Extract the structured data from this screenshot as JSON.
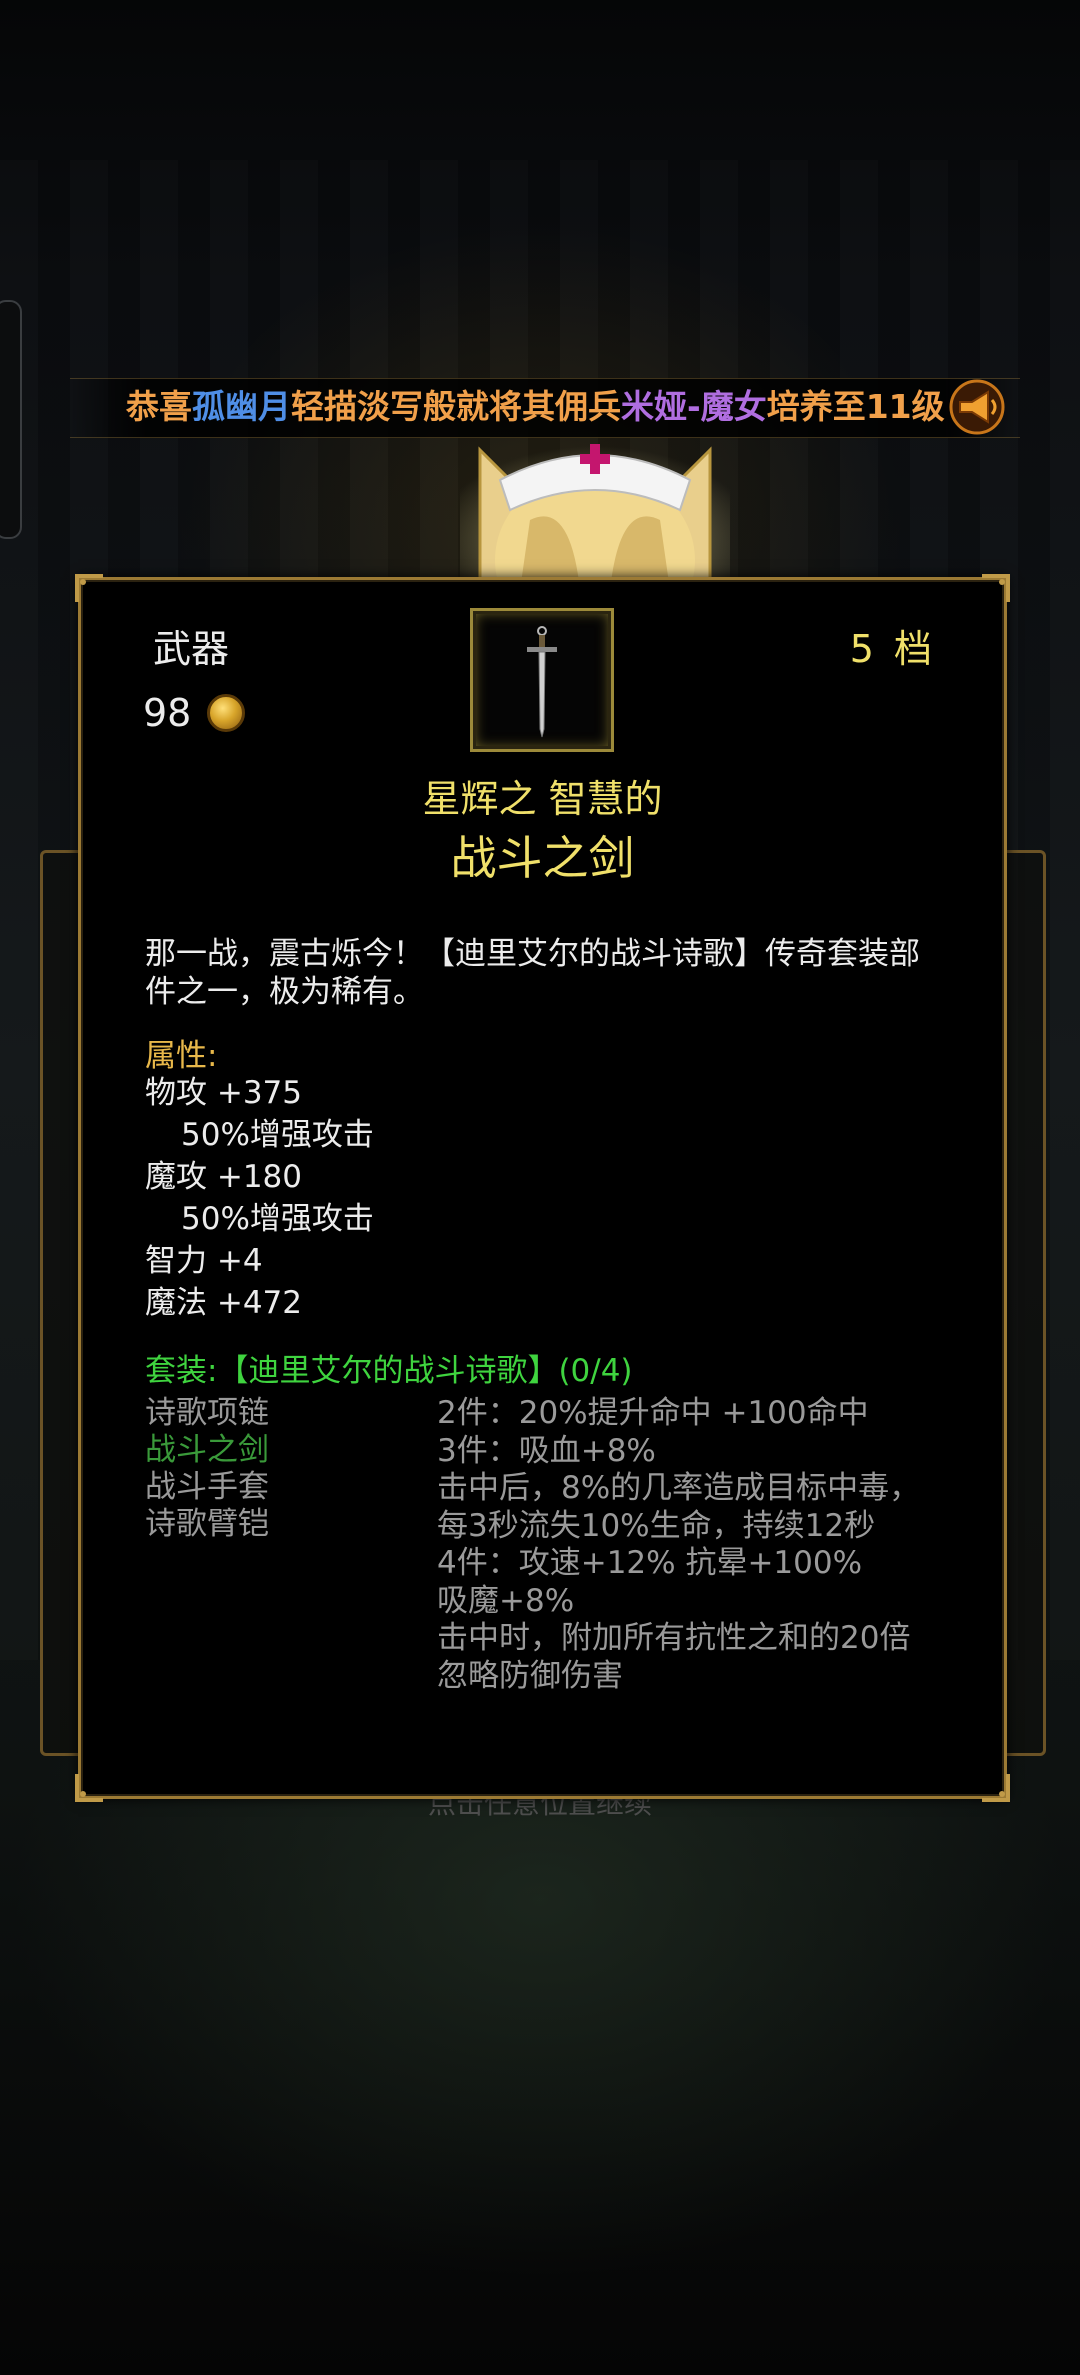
{
  "marquee": {
    "segments": [
      {
        "text": "恭喜",
        "color": "orange"
      },
      {
        "text": "孤幽月",
        "color": "blue"
      },
      {
        "text": "轻描淡写般就将其佣兵",
        "color": "orange"
      },
      {
        "text": "米娅-魔女",
        "color": "purple"
      },
      {
        "text": "培养至11级",
        "color": "orange"
      }
    ]
  },
  "background": {
    "continue_hint": "点击任意位置继续"
  },
  "item": {
    "slot_type": "武器",
    "grade_number": "5",
    "grade_unit": "档",
    "price": "98",
    "prefix_line": "星辉之 智慧的",
    "name": "战斗之剑",
    "description": "那一战，震古烁今！【迪里艾尔的战斗诗歌】传奇套装部件之一，极为稀有。",
    "attributes_title": "属性:",
    "attributes": [
      {
        "text": "物攻 +375",
        "indent": false
      },
      {
        "text": "50%增强攻击",
        "indent": true
      },
      {
        "text": "魔攻 +180",
        "indent": false
      },
      {
        "text": "50%增强攻击",
        "indent": true
      },
      {
        "text": "智力 +4",
        "indent": false
      },
      {
        "text": "魔法 +472",
        "indent": false
      }
    ],
    "set": {
      "title": "套装:【迪里艾尔的战斗诗歌】(0/4)",
      "pieces": [
        {
          "name": "诗歌项链",
          "owned": false
        },
        {
          "name": "战斗之剑",
          "owned": true
        },
        {
          "name": "战斗手套",
          "owned": false
        },
        {
          "name": "诗歌臂铠",
          "owned": false
        }
      ],
      "bonuses": [
        "2件：20%提升命中 +100命中",
        "3件：吸血+8%",
        "击中后，8%的几率造成目标中毒，",
        "每3秒流失10%生命，持续12秒",
        "4件：攻速+12% 抗晕+100%",
        "吸魔+8%",
        "击中时，附加所有抗性之和的20倍",
        "忽略防御伤害"
      ]
    }
  },
  "icons": {
    "coin": "gold-coin-icon",
    "sword": "sword-icon",
    "megaphone": "megaphone-icon"
  },
  "colors": {
    "gold_text": "#f0e06a",
    "attribute_title": "#e8b84a",
    "set_green": "#3fd43f",
    "owned_piece": "#3a9a3a",
    "frame_gold": "#9c7a34"
  }
}
